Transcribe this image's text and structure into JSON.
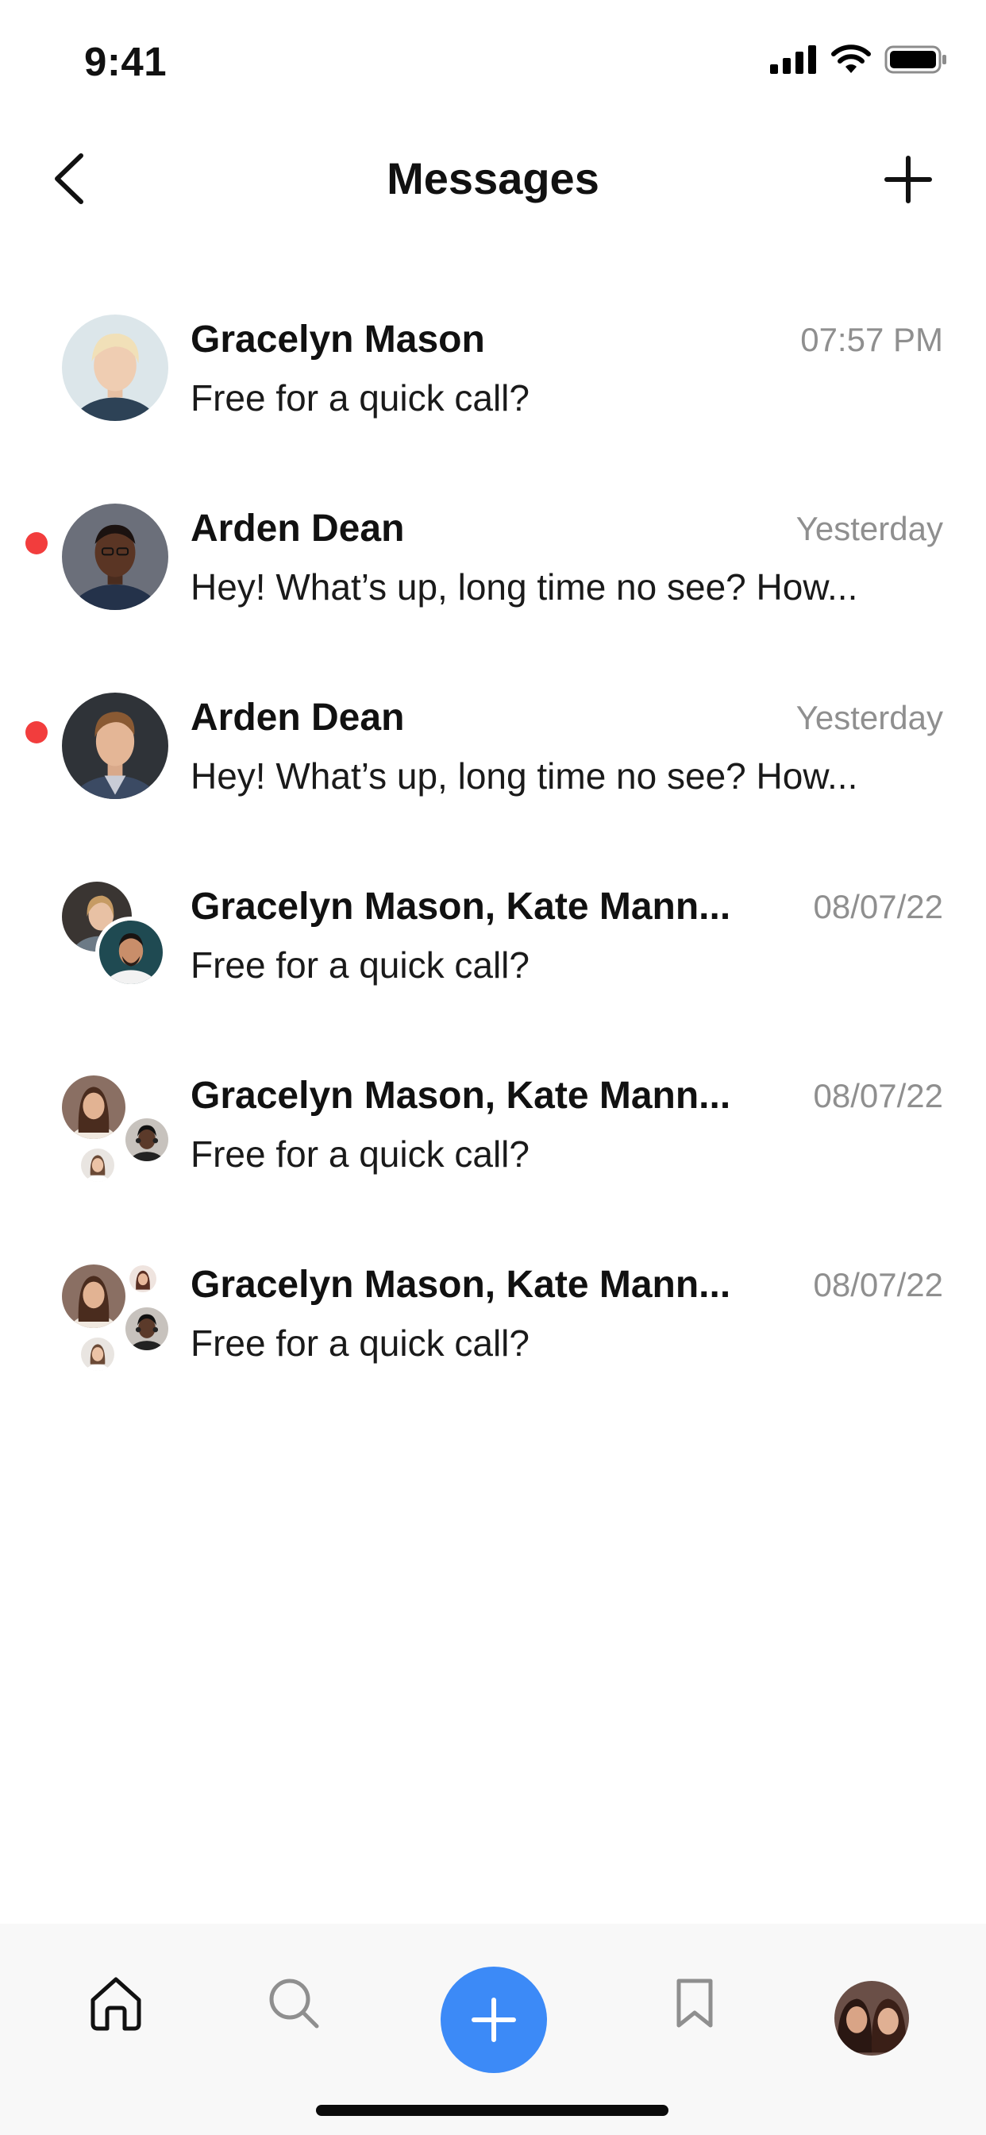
{
  "status_bar": {
    "time": "9:41",
    "icons": [
      "cellular-signal-icon",
      "wifi-icon",
      "battery-icon"
    ]
  },
  "header": {
    "title": "Messages",
    "back_icon": "chevron-left-icon",
    "new_icon": "plus-icon"
  },
  "conversations": [
    {
      "name": "Gracelyn Mason",
      "time": "07:57 PM",
      "preview": "Free for a quick call?",
      "unread": false
    },
    {
      "name": "Arden Dean",
      "time": "Yesterday",
      "preview": "Hey! What’s up, long time no see? How...",
      "unread": true
    },
    {
      "name": "Arden Dean",
      "time": "Yesterday",
      "preview": "Hey! What’s up, long time no see? How...",
      "unread": true
    },
    {
      "name": "Gracelyn Mason, Kate Mann...",
      "time": "08/07/22",
      "preview": "Free for a quick call?",
      "unread": false
    },
    {
      "name": "Gracelyn Mason, Kate Mann...",
      "time": "08/07/22",
      "preview": "Free for a quick call?",
      "unread": false
    },
    {
      "name": "Gracelyn Mason, Kate Mann...",
      "time": "08/07/22",
      "preview": "Free for a quick call?",
      "unread": false
    }
  ],
  "tab_bar": {
    "tabs": [
      "home-icon",
      "search-icon",
      "plus-icon",
      "bookmark-icon",
      "profile-avatar"
    ],
    "accent_color": "#3c8af7"
  },
  "colors": {
    "unread_dot": "#f23d3d",
    "timestamp": "#8f8f8f",
    "tab_bar_bg": "#f8f8f8"
  }
}
